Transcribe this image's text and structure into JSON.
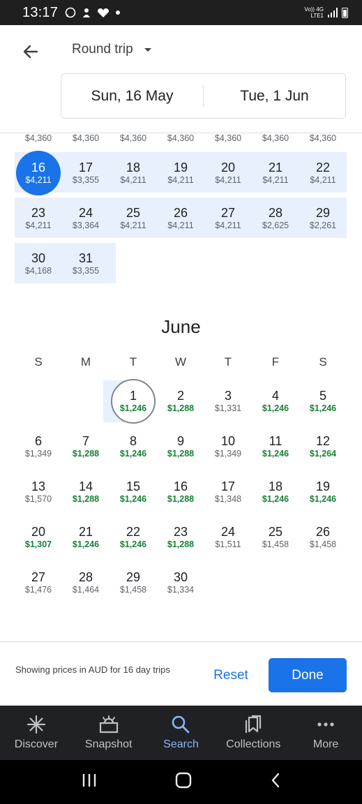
{
  "status_bar": {
    "time": "13:17",
    "network_label": "Vo)) 4G LTE1"
  },
  "header": {
    "back_icon": "arrow-left-icon",
    "trip_type": "Round trip",
    "depart_date": "Sun, 16 May",
    "return_date": "Tue, 1 Jun"
  },
  "may": {
    "partial_row_prices": [
      "$4,360",
      "$4,360",
      "$4,360",
      "$4,360",
      "$4,360",
      "$4,360",
      "$4,360"
    ],
    "rows": [
      [
        {
          "day": "16",
          "price": "$4,211",
          "selected": true
        },
        {
          "day": "17",
          "price": "$3,355"
        },
        {
          "day": "18",
          "price": "$4,211"
        },
        {
          "day": "19",
          "price": "$4,211"
        },
        {
          "day": "20",
          "price": "$4,211"
        },
        {
          "day": "21",
          "price": "$4,211"
        },
        {
          "day": "22",
          "price": "$4,211"
        }
      ],
      [
        {
          "day": "23",
          "price": "$4,211"
        },
        {
          "day": "24",
          "price": "$3,364"
        },
        {
          "day": "25",
          "price": "$4,211"
        },
        {
          "day": "26",
          "price": "$4,211"
        },
        {
          "day": "27",
          "price": "$4,211"
        },
        {
          "day": "28",
          "price": "$2,625"
        },
        {
          "day": "29",
          "price": "$2,261"
        }
      ],
      [
        {
          "day": "30",
          "price": "$4,168"
        },
        {
          "day": "31",
          "price": "$3,355"
        }
      ]
    ]
  },
  "june": {
    "title": "June",
    "weekdays": [
      "S",
      "M",
      "T",
      "W",
      "T",
      "F",
      "S"
    ],
    "rows": [
      [
        null,
        null,
        {
          "day": "1",
          "price": "$1,246",
          "cheap": true,
          "ring": true
        },
        {
          "day": "2",
          "price": "$1,288",
          "cheap": true
        },
        {
          "day": "3",
          "price": "$1,331"
        },
        {
          "day": "4",
          "price": "$1,246",
          "cheap": true
        },
        {
          "day": "5",
          "price": "$1,246",
          "cheap": true
        }
      ],
      [
        {
          "day": "6",
          "price": "$1,349"
        },
        {
          "day": "7",
          "price": "$1,288",
          "cheap": true
        },
        {
          "day": "8",
          "price": "$1,246",
          "cheap": true
        },
        {
          "day": "9",
          "price": "$1,288",
          "cheap": true
        },
        {
          "day": "10",
          "price": "$1,349"
        },
        {
          "day": "11",
          "price": "$1,246",
          "cheap": true
        },
        {
          "day": "12",
          "price": "$1,264",
          "cheap": true
        }
      ],
      [
        {
          "day": "13",
          "price": "$1,570"
        },
        {
          "day": "14",
          "price": "$1,288",
          "cheap": true
        },
        {
          "day": "15",
          "price": "$1,246",
          "cheap": true
        },
        {
          "day": "16",
          "price": "$1,288",
          "cheap": true
        },
        {
          "day": "17",
          "price": "$1,348"
        },
        {
          "day": "18",
          "price": "$1,246",
          "cheap": true
        },
        {
          "day": "19",
          "price": "$1,246",
          "cheap": true
        }
      ],
      [
        {
          "day": "20",
          "price": "$1,307",
          "cheap": true
        },
        {
          "day": "21",
          "price": "$1,246",
          "cheap": true
        },
        {
          "day": "22",
          "price": "$1,246",
          "cheap": true
        },
        {
          "day": "23",
          "price": "$1,288",
          "cheap": true
        },
        {
          "day": "24",
          "price": "$1,511"
        },
        {
          "day": "25",
          "price": "$1,458"
        },
        {
          "day": "26",
          "price": "$1,458"
        }
      ],
      [
        {
          "day": "27",
          "price": "$1,476"
        },
        {
          "day": "28",
          "price": "$1,464"
        },
        {
          "day": "29",
          "price": "$1,458"
        },
        {
          "day": "30",
          "price": "$1,334"
        }
      ]
    ]
  },
  "footer": {
    "note": "Showing prices in AUD for 16 day trips",
    "reset_label": "Reset",
    "done_label": "Done"
  },
  "bottom_nav": [
    {
      "label": "Discover",
      "icon": "sparkle-icon"
    },
    {
      "label": "Snapshot",
      "icon": "snapshot-icon"
    },
    {
      "label": "Search",
      "icon": "search-icon",
      "active": true
    },
    {
      "label": "Collections",
      "icon": "collections-icon"
    },
    {
      "label": "More",
      "icon": "more-dots-icon"
    }
  ],
  "colors": {
    "accent": "#1a73e8",
    "range_band": "#e8f0fe",
    "cheap_price": "#188038",
    "nav_bg": "#202124",
    "nav_active": "#8ab4f8"
  }
}
